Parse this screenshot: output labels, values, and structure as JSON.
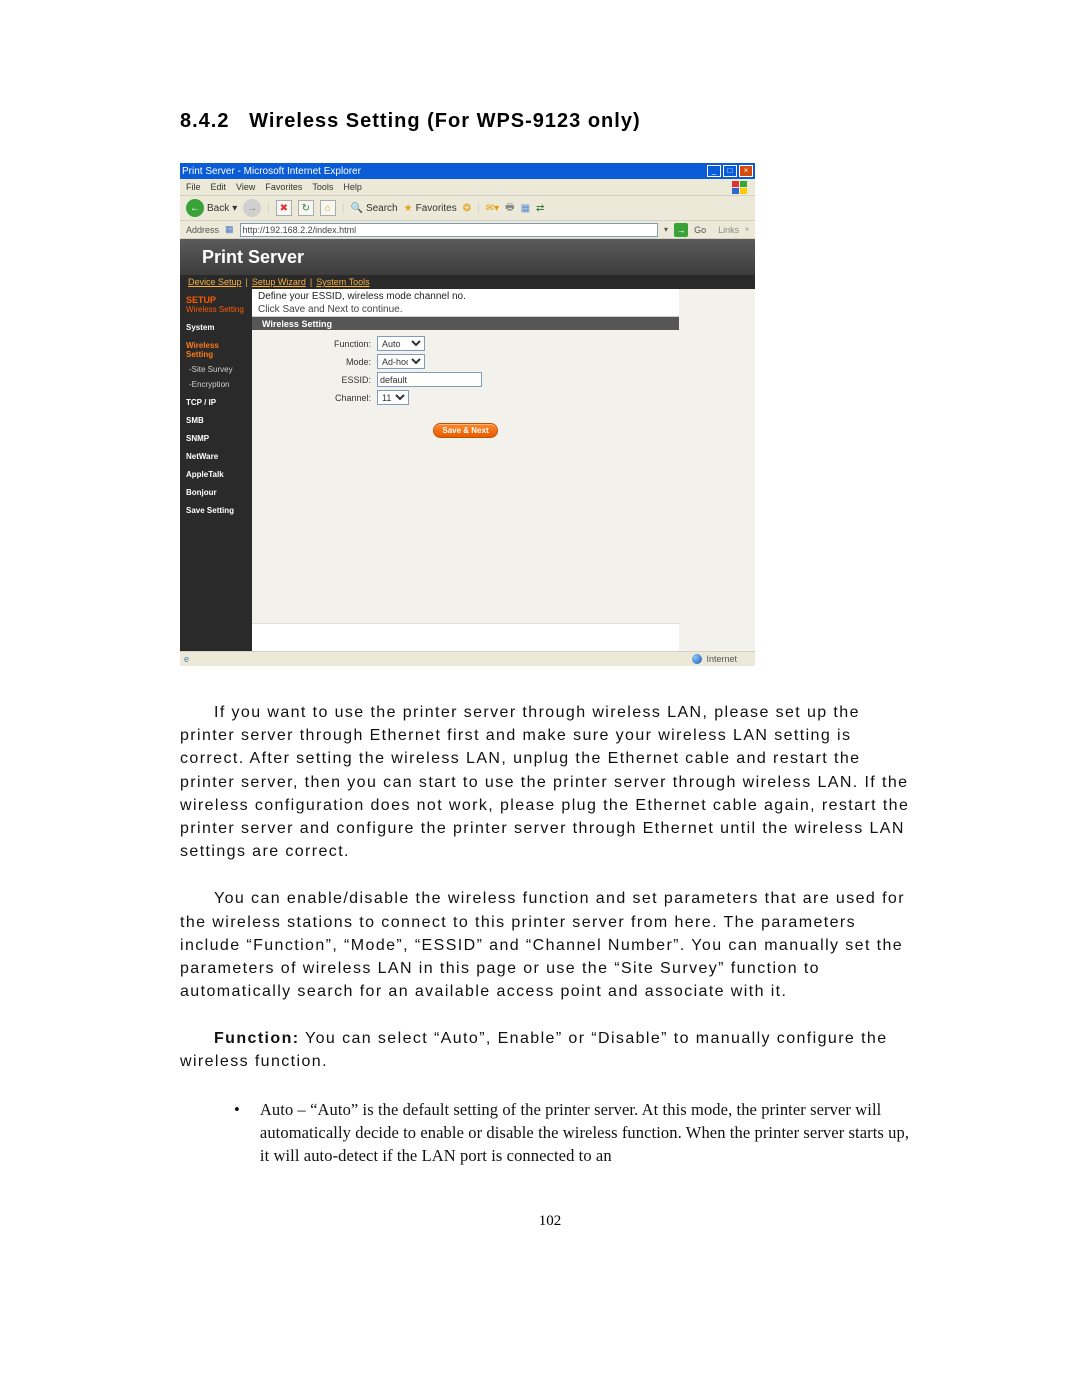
{
  "section_number": "8.4.2",
  "section_title": "Wireless Setting (For WPS-9123 only)",
  "page_number": "102",
  "screenshot": {
    "window_title": "Print Server - Microsoft Internet Explorer",
    "menus": {
      "file": "File",
      "edit": "Edit",
      "view": "View",
      "favorites": "Favorites",
      "tools": "Tools",
      "help": "Help"
    },
    "toolbar": {
      "back": "Back",
      "search": "Search",
      "favorites": "Favorites"
    },
    "address_label": "Address",
    "address_value": "http://192.168.2.2/index.html",
    "go": "Go",
    "links": "Links",
    "banner": "Print Server",
    "tabs": {
      "device": "Device Setup",
      "wizard": "Setup Wizard",
      "tools": "System Tools"
    },
    "sidebar": {
      "setup": "SETUP",
      "wireless_setting": "Wireless Setting",
      "system": "System",
      "wireless_setting2": "Wireless Setting",
      "site_survey": "-Site Survey",
      "encryption": "-Encryption",
      "tcpip": "TCP / IP",
      "smb": "SMB",
      "snmp": "SNMP",
      "netware": "NetWare",
      "appletalk": "AppleTalk",
      "bonjour": "Bonjour",
      "save": "Save Setting"
    },
    "content_top_line1": "Define your ESSID, wireless mode channel no.",
    "content_top_line2": "Click Save and Next to continue.",
    "section_bar": "Wireless Setting",
    "form": {
      "function_label": "Function:",
      "function_value": "Auto",
      "mode_label": "Mode:",
      "mode_value": "Ad-hoc",
      "essid_label": "ESSID:",
      "essid_value": "default",
      "channel_label": "Channel:",
      "channel_value": "11"
    },
    "save_button": "Save & Next",
    "status_zone": "Internet"
  },
  "body": {
    "p1": "If you want to use the printer server through wireless LAN, please set up the printer server through Ethernet first and make sure your wireless LAN setting is correct. After setting the wireless LAN, unplug the Ethernet cable and restart the printer server, then you can start to use the printer server through wireless LAN. If the wireless configuration does not work, please plug the Ethernet cable again, restart the printer server and configure the printer server through Ethernet until the wireless LAN settings are correct.",
    "p2": "You can enable/disable the wireless function and set parameters that are used for the wireless stations to connect to this printer server from here. The parameters include “Function”, “Mode”, “ESSID” and “Channel Number”. You can manually set the parameters of wireless LAN in this page or use the “Site Survey” function to automatically search for an available access point and associate with it.",
    "p3_bold": "Function:",
    "p3_rest": " You can select “Auto”, Enable” or “Disable” to manually configure the wireless function.",
    "bullet1": "Auto – “Auto” is the default setting of the printer server. At this mode, the printer server will automatically decide to enable or disable the wireless function. When the printer server starts up, it will auto-detect if the LAN port is connected to an"
  }
}
